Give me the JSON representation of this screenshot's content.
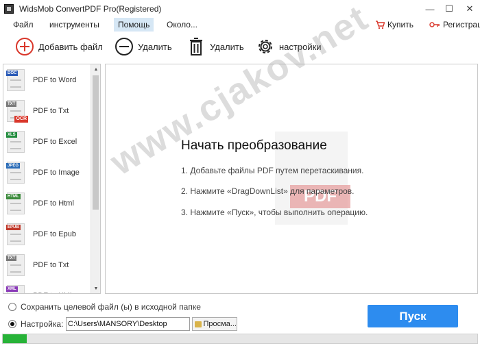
{
  "window": {
    "title": "WidsMob ConvertPDF Pro(Registered)",
    "minimize": "—",
    "maximize": "☐",
    "close": "✕"
  },
  "menu": {
    "items": [
      "Файл",
      "инструменты",
      "Помощь",
      "Около..."
    ],
    "buy_label": "Купить",
    "register_label": "Регистрац"
  },
  "toolbar": {
    "add_label": "Добавить файл",
    "remove_label": "Удалить",
    "delete_label": "Удалить",
    "settings_label": "настройки"
  },
  "sidebar": {
    "items": [
      {
        "label": "PDF to Word",
        "tag": "DOC",
        "tag_color": "#2b5bb7"
      },
      {
        "label": "PDF to Txt",
        "tag": "TXT",
        "tag_color": "#7a7a7a",
        "badge": "OCR"
      },
      {
        "label": "PDF to Excel",
        "tag": "XLS",
        "tag_color": "#1f8a3b"
      },
      {
        "label": "PDF to Image",
        "tag": "JPEG",
        "tag_color": "#2b6cb7"
      },
      {
        "label": "PDF to Html",
        "tag": "HTML",
        "tag_color": "#3a8a3a"
      },
      {
        "label": "PDF to Epub",
        "tag": "EPUB",
        "tag_color": "#c0392b"
      },
      {
        "label": "PDF to Txt",
        "tag": "TXT",
        "tag_color": "#7a7a7a"
      },
      {
        "label": "PDF to XML",
        "tag": "XML",
        "tag_color": "#8a3ab7"
      }
    ]
  },
  "main": {
    "title": "Начать преобразование",
    "steps": [
      "1. Добавьте файлы PDF путем перетаскивания.",
      "2. Нажмите «DragDownList» для параметров.",
      "3. Нажмите «Пуск», чтобы выполнить операцию."
    ],
    "pdf_badge": "PDF"
  },
  "watermark": "www.cjakov.net",
  "options": {
    "save_source_label": "Сохранить целевой файл (ы) в исходной папке",
    "custom_label": "Настройка:",
    "path_value": "C:\\Users\\MANSORY\\Desktop",
    "browse_label": "Просма..."
  },
  "start_label": "Пуск",
  "progress": {
    "fraction": 0.05,
    "color": "#27b338"
  },
  "colors": {
    "accent": "#2d8cef",
    "danger": "#d9372b",
    "menu_active": "#d6e7f5"
  }
}
